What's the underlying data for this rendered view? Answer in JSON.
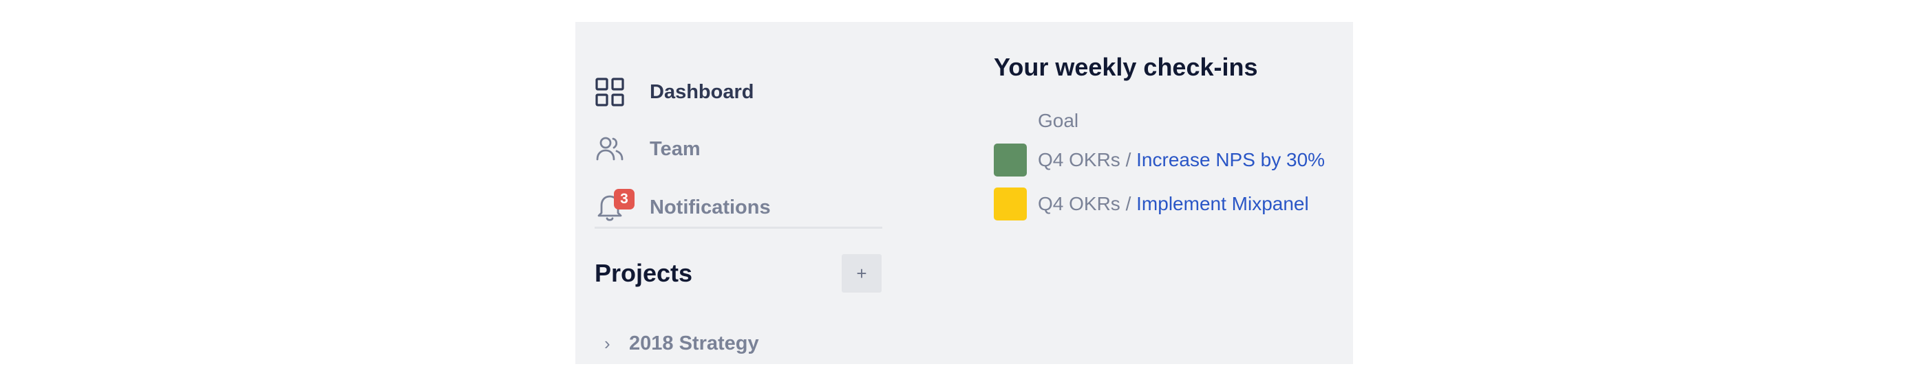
{
  "nav": {
    "items": [
      {
        "label": "Dashboard",
        "icon": "grid-icon",
        "active": true
      },
      {
        "label": "Team",
        "icon": "users-icon",
        "active": false
      },
      {
        "label": "Notifications",
        "icon": "bell-icon",
        "active": false,
        "badge": "3"
      }
    ]
  },
  "projects": {
    "title": "Projects",
    "add_label": "+",
    "items": [
      {
        "label": "2018 Strategy",
        "chevron": "›"
      }
    ]
  },
  "checkins": {
    "title": "Your weekly check-ins",
    "column_header": "Goal",
    "rows": [
      {
        "prefix": "Q4 OKRs / ",
        "goal": "Increase NPS by 30%",
        "color": "#5f8f63"
      },
      {
        "prefix": "Q4 OKRs / ",
        "goal": "Implement Mixpanel",
        "color": "#fccb12"
      }
    ]
  },
  "colors": {
    "panel_bg": "#f1f2f4",
    "badge": "#e3574f",
    "link": "#2a56c6"
  }
}
